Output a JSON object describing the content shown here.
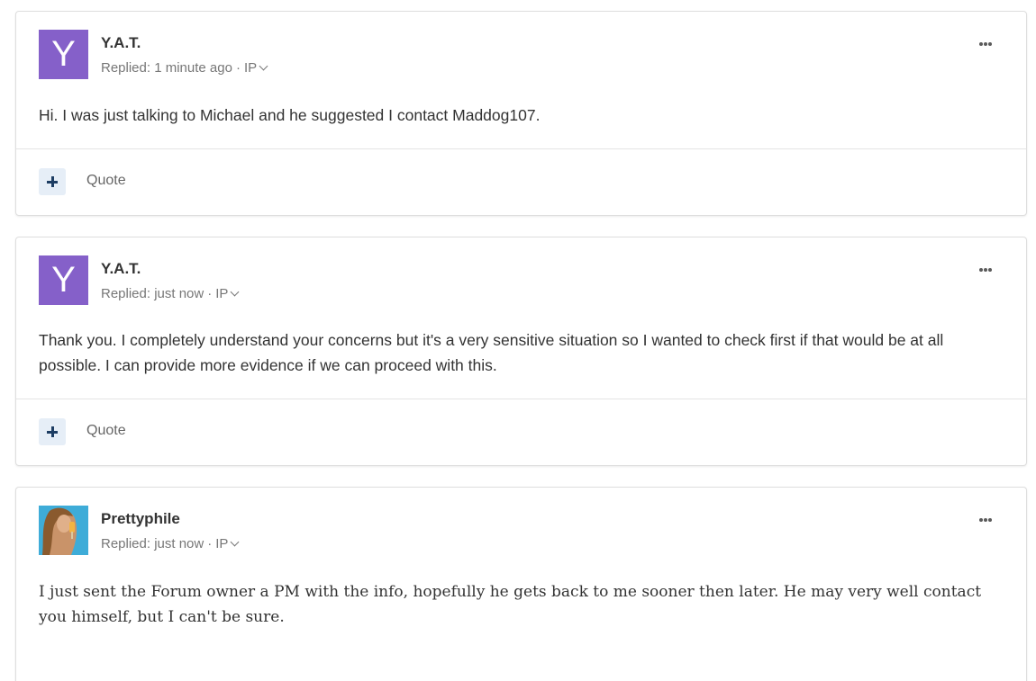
{
  "posts": [
    {
      "avatar_letter": "Y",
      "author": "Y.A.T.",
      "meta_prefix": "Replied: 1 minute ago",
      "meta_ip": "IP",
      "body": "Hi. I was just talking to Michael and he suggested I contact Maddog107.",
      "quote_label": "Quote"
    },
    {
      "avatar_letter": "Y",
      "author": "Y.A.T.",
      "meta_prefix": "Replied: just now",
      "meta_ip": "IP",
      "body": "Thank you. I completely understand your concerns but it's a very sensitive situation so I wanted to check first if that would be at all possible. I can provide more evidence if we can proceed with this.",
      "quote_label": "Quote"
    },
    {
      "author": "Prettyphile",
      "meta_prefix": "Replied: just now",
      "meta_ip": "IP",
      "body": "I just sent the Forum owner a PM with the info, hopefully he gets back to me sooner then later. He may very well contact you himself, but I can't be sure."
    }
  ],
  "colors": {
    "avatar_purple": "#8560c9",
    "plus_button_bg": "#e6eef7",
    "plus_icon": "#1d3d63"
  },
  "icons": {
    "more": "more-options-icon",
    "chevron": "chevron-down-icon",
    "plus": "plus-icon"
  }
}
